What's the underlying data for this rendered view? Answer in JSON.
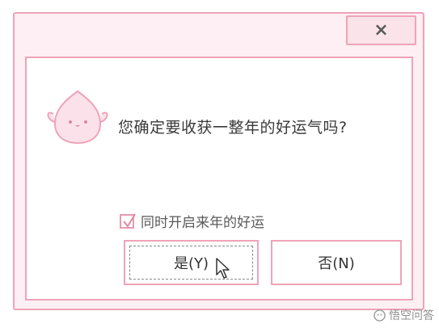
{
  "dialog": {
    "close_label": "×",
    "message": "您确定要收获一整年的好运气吗?",
    "checkbox": {
      "label": "同时开启来年的好运",
      "checked": true
    },
    "buttons": {
      "yes_label": "是(Y)",
      "no_label": "否(N)"
    }
  },
  "watermark": {
    "text": "悟空问答"
  },
  "colors": {
    "border_pink": "#efa3b9",
    "titlebar_bg": "#fdeff3",
    "mascot_fill": "#fbe2ea"
  },
  "icons": {
    "close": "close-icon",
    "mascot": "peach-mascot-icon",
    "cursor": "mouse-pointer-icon",
    "checkmark": "checkmark-icon",
    "watermark": "wukong-logo-icon"
  }
}
